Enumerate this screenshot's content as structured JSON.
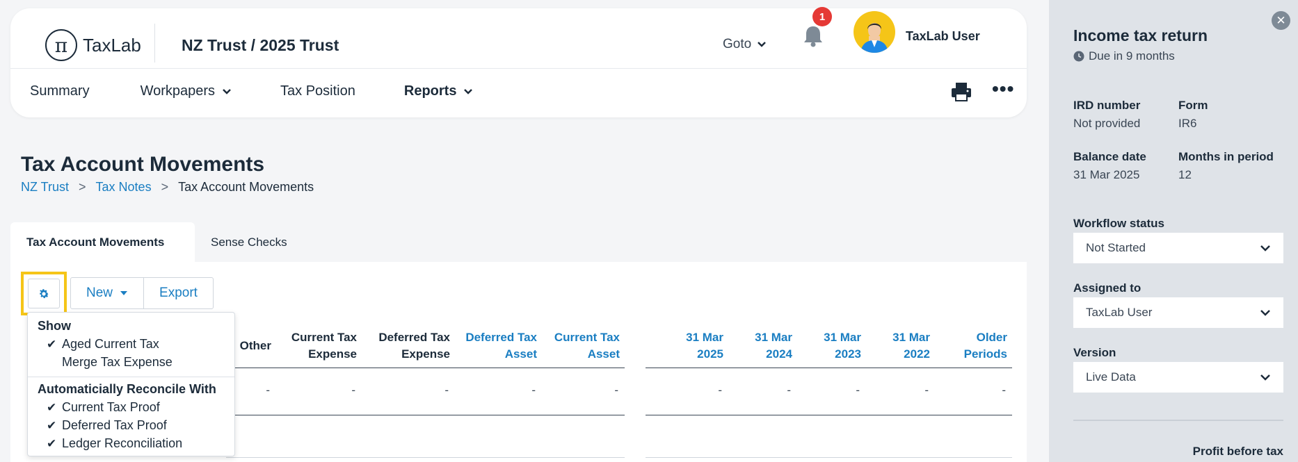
{
  "header": {
    "logo_text": "TaxLab",
    "entity_title": "NZ Trust / 2025 Trust",
    "goto_label": "Goto",
    "notification_count": "1",
    "user_name": "TaxLab User"
  },
  "nav": {
    "items": [
      {
        "label": "Summary"
      },
      {
        "label": "Workpapers"
      },
      {
        "label": "Tax Position"
      },
      {
        "label": "Reports"
      }
    ]
  },
  "page": {
    "title": "Tax Account Movements",
    "breadcrumb": [
      "NZ Trust",
      ">",
      "Tax Notes",
      ">",
      "Tax Account Movements"
    ]
  },
  "tabs": [
    {
      "label": "Tax Account Movements"
    },
    {
      "label": "Sense Checks"
    }
  ],
  "toolbar": {
    "new_label": "New",
    "export_label": "Export"
  },
  "settings_menu": {
    "show_heading": "Show",
    "show_items": [
      {
        "label": "Aged Current Tax",
        "checked": true
      },
      {
        "label": "Merge Tax Expense",
        "checked": false
      }
    ],
    "reconcile_heading": "Automaticially Reconcile With",
    "reconcile_items": [
      {
        "label": "Current Tax Proof",
        "checked": true
      },
      {
        "label": "Deferred Tax Proof",
        "checked": true
      },
      {
        "label": "Ledger Reconciliation",
        "checked": true
      }
    ]
  },
  "table": {
    "columns": [
      {
        "line1": "",
        "line2": "Other"
      },
      {
        "line1": "Current Tax",
        "line2": "Expense"
      },
      {
        "line1": "Deferred Tax",
        "line2": "Expense"
      },
      {
        "line1": "Deferred Tax",
        "line2": "Asset"
      },
      {
        "line1": "Current Tax",
        "line2": "Asset"
      },
      {
        "line1": "31 Mar",
        "line2": "2025"
      },
      {
        "line1": "31 Mar",
        "line2": "2024"
      },
      {
        "line1": "31 Mar",
        "line2": "2023"
      },
      {
        "line1": "31 Mar",
        "line2": "2022"
      },
      {
        "line1": "Older",
        "line2": "Periods"
      }
    ],
    "row": [
      "-",
      "-",
      "-",
      "-",
      "-",
      "-",
      "-",
      "-",
      "-",
      "-"
    ]
  },
  "side_panel": {
    "title": "Income tax return",
    "due": "Due in 9 months",
    "ird_label": "IRD number",
    "ird_value": "Not provided",
    "form_label": "Form",
    "form_value": "IR6",
    "balance_label": "Balance date",
    "balance_value": "31 Mar 2025",
    "months_label": "Months in period",
    "months_value": "12",
    "workflow_label": "Workflow status",
    "workflow_value": "Not Started",
    "assigned_label": "Assigned to",
    "assigned_value": "TaxLab User",
    "version_label": "Version",
    "version_value": "Live Data",
    "profit_label": "Profit before tax"
  },
  "colors": {
    "accent_blue": "#1a7ec2",
    "highlight_yellow": "#f5c518",
    "badge_red": "#e53935"
  }
}
